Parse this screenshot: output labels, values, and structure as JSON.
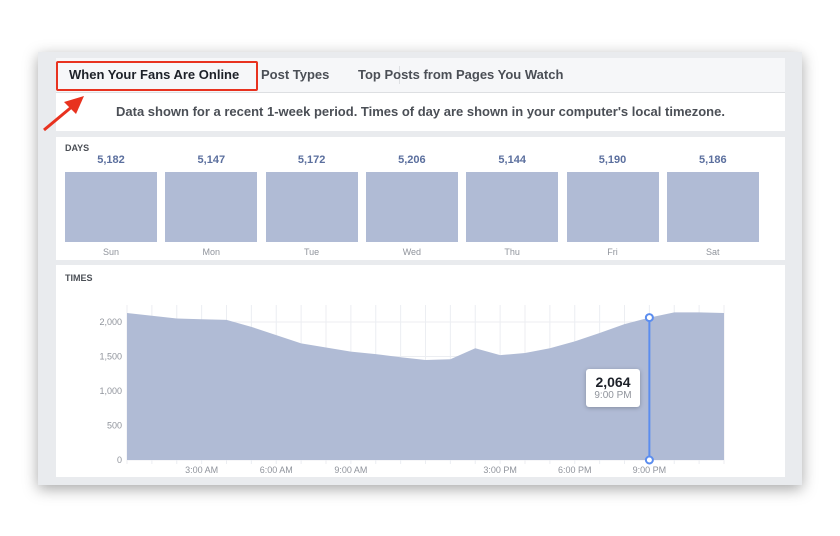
{
  "tabs": [
    {
      "label": "When Your Fans Are Online",
      "active": true
    },
    {
      "label": "Post Types"
    },
    {
      "label": "Top Posts from Pages You Watch"
    }
  ],
  "description": "Data shown for a recent 1-week period. Times of day are shown in your computer's local timezone.",
  "days": {
    "title": "DAYS",
    "items": [
      {
        "day": "Sun",
        "value": "5,182"
      },
      {
        "day": "Mon",
        "value": "5,147"
      },
      {
        "day": "Tue",
        "value": "5,172"
      },
      {
        "day": "Wed",
        "value": "5,206"
      },
      {
        "day": "Thu",
        "value": "5,144"
      },
      {
        "day": "Fri",
        "value": "5,190"
      },
      {
        "day": "Sat",
        "value": "5,186"
      }
    ]
  },
  "colors": {
    "area": "#b0bbd5",
    "highlight": "#e8321f",
    "cursor": "#5b8def"
  },
  "chart_data": {
    "type": "area",
    "title": "TIMES",
    "x": [
      0,
      1,
      2,
      3,
      4,
      5,
      6,
      7,
      8,
      9,
      10,
      11,
      12,
      13,
      14,
      15,
      16,
      17,
      18,
      19,
      20,
      21,
      22,
      23,
      24
    ],
    "values": [
      2130,
      2090,
      2050,
      2040,
      2030,
      1930,
      1810,
      1690,
      1630,
      1570,
      1535,
      1490,
      1450,
      1460,
      1620,
      1520,
      1550,
      1620,
      1720,
      1840,
      1970,
      2064,
      2140,
      2140,
      2130
    ],
    "ylim": [
      0,
      2200
    ],
    "yticks": [
      "0",
      "500",
      "1,000",
      "1,500",
      "2,000"
    ],
    "xticks": [
      {
        "hour": 3,
        "label": "3:00 AM"
      },
      {
        "hour": 6,
        "label": "6:00 AM"
      },
      {
        "hour": 9,
        "label": "9:00 AM"
      },
      {
        "hour": 15,
        "label": "3:00 PM"
      },
      {
        "hour": 18,
        "label": "6:00 PM"
      },
      {
        "hour": 21,
        "label": "9:00 PM"
      }
    ],
    "grid": true,
    "tooltip": {
      "hour": 21,
      "value": "2,064",
      "time": "9:00 PM"
    }
  }
}
